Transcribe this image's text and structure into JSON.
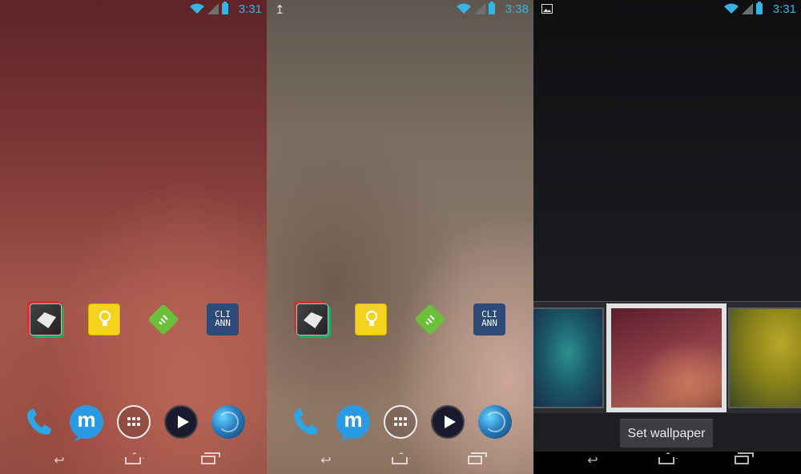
{
  "screens": [
    {
      "id": "home-red",
      "status": {
        "time": "3:31"
      },
      "apps": [
        {
          "name": "origami-app"
        },
        {
          "name": "lightbulb-notes-app"
        },
        {
          "name": "feedly-app"
        },
        {
          "label_top": "CLI",
          "label_bottom": "ANN"
        }
      ]
    },
    {
      "id": "home-beige",
      "status": {
        "time": "3:38"
      },
      "apps": [
        {
          "name": "origami-app"
        },
        {
          "name": "lightbulb-notes-app"
        },
        {
          "name": "feedly-app"
        },
        {
          "label_top": "CLI",
          "label_bottom": "ANN"
        }
      ]
    },
    {
      "id": "wallpaper-picker",
      "status": {
        "time": "3:31"
      },
      "action": {
        "label": "Set wallpaper"
      }
    }
  ],
  "dock_letter": "m",
  "colors": {
    "status_accent": "#33b5e5"
  }
}
